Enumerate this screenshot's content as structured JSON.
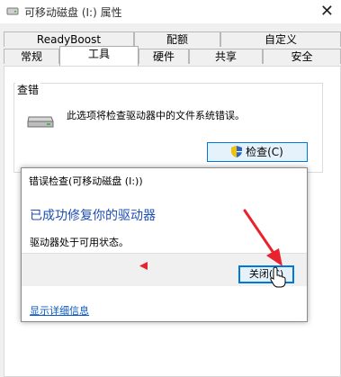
{
  "window": {
    "title": "可移动磁盘 (I:) 属性",
    "close_glyph": "✕"
  },
  "tabs_row1": [
    {
      "label": "ReadyBoost"
    },
    {
      "label": "配额"
    },
    {
      "label": "自定义"
    }
  ],
  "tabs_row2": [
    {
      "label": "常规"
    },
    {
      "label": "工具",
      "active": true
    },
    {
      "label": "硬件"
    },
    {
      "label": "共享"
    },
    {
      "label": "安全"
    }
  ],
  "error_check_group": {
    "title": "查错",
    "description": "此选项将检查驱动器中的文件系统错误。",
    "check_button": "检查(C)",
    "icons": {
      "drive": "drive-icon",
      "shield": "uac-shield-icon"
    }
  },
  "dialog": {
    "title": "错误检查(可移动磁盘 (I:))",
    "heading": "已成功修复你的驱动器",
    "status": "驱动器处于可用状态。",
    "close_button": "关闭(C)",
    "details_link": "显示详细信息"
  },
  "colors": {
    "heading_blue": "#1e4fb4",
    "link_blue": "#0a58c4",
    "focus_blue": "#0078d7",
    "annotation_red": "#e8232d"
  }
}
